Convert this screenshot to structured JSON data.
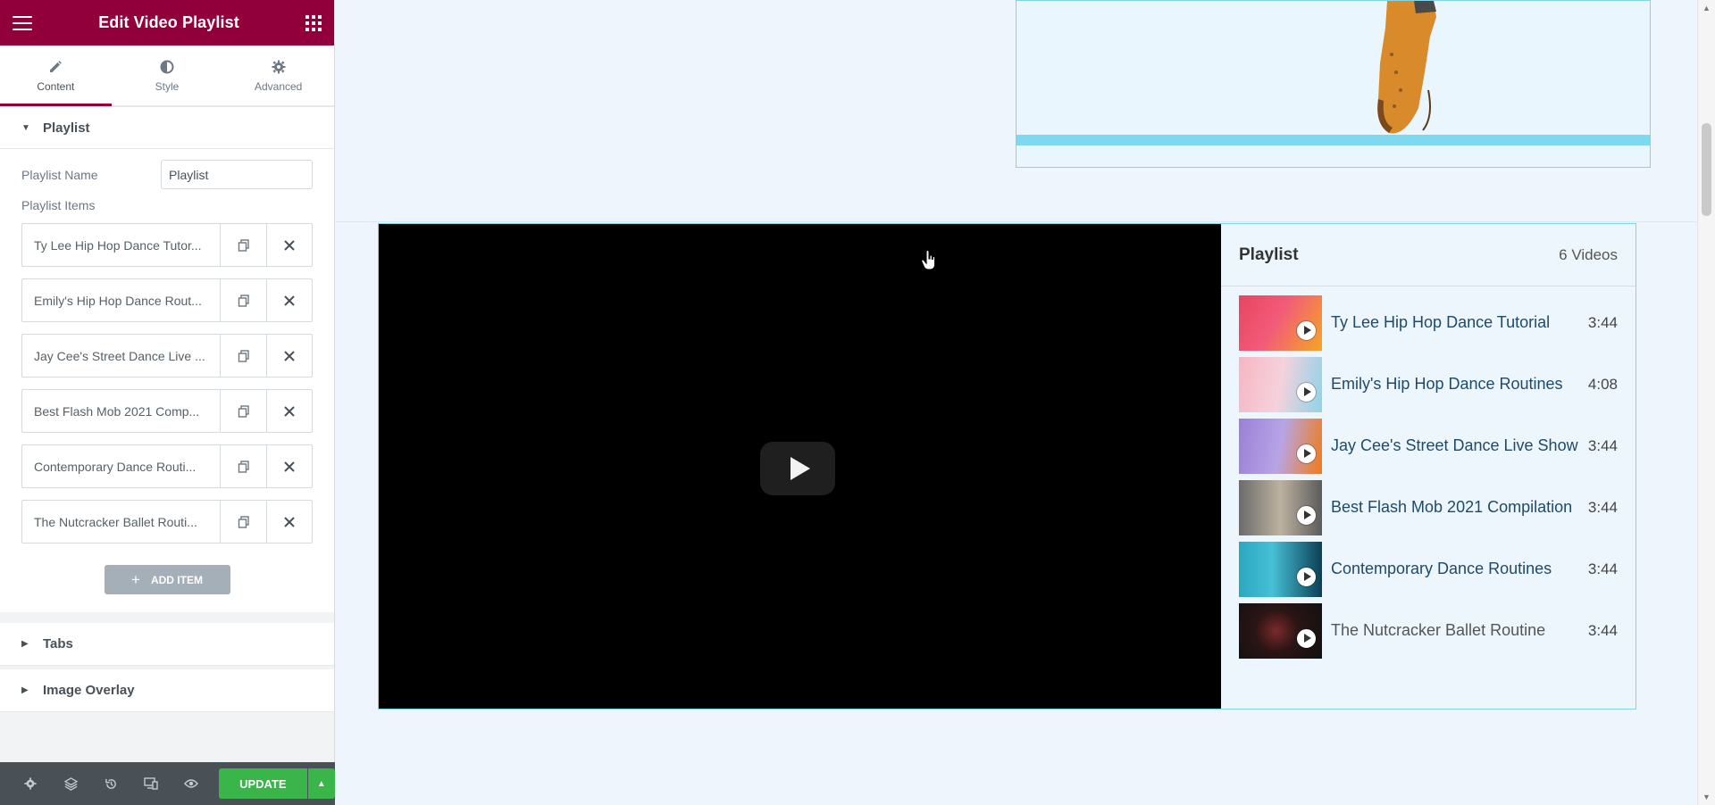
{
  "panel": {
    "title": "Edit Video Playlist",
    "tabs": [
      {
        "label": "Content",
        "icon": "pencil-icon"
      },
      {
        "label": "Style",
        "icon": "contrast-icon"
      },
      {
        "label": "Advanced",
        "icon": "gear-icon"
      }
    ],
    "section_playlist": "Playlist",
    "playlist_name_label": "Playlist Name",
    "playlist_name_value": "Playlist",
    "playlist_items_label": "Playlist Items",
    "items": [
      {
        "title": "Ty Lee Hip Hop Dance Tutor..."
      },
      {
        "title": "Emily's Hip Hop Dance Rout..."
      },
      {
        "title": "Jay Cee's Street Dance Live ..."
      },
      {
        "title": "Best Flash Mob 2021 Comp..."
      },
      {
        "title": "Contemporary Dance Routi..."
      },
      {
        "title": "The Nutcracker Ballet Routi..."
      }
    ],
    "add_item_label": "ADD ITEM",
    "section_tabs": "Tabs",
    "section_image_overlay": "Image Overlay",
    "update_label": "UPDATE",
    "accent_color": "#92003b",
    "update_color": "#39b54a"
  },
  "preview": {
    "playlist_title": "Playlist",
    "video_count": "6 Videos",
    "videos": [
      {
        "name": "Ty Lee Hip Hop Dance Tutorial",
        "duration": "3:44",
        "thumb": [
          "#e8455e",
          "#f5a623"
        ]
      },
      {
        "name": "Emily's Hip Hop Dance Routines",
        "duration": "4:08",
        "thumb": [
          "#f7b6c2",
          "#8fd3e8"
        ]
      },
      {
        "name": "Jay Cee's Street Dance Live Show",
        "duration": "3:44",
        "thumb": [
          "#9b7fd6",
          "#f07b1a"
        ]
      },
      {
        "name": "Best Flash Mob 2021 Compilation",
        "duration": "3:44",
        "thumb": [
          "#6b6b6b",
          "#c9b79c"
        ]
      },
      {
        "name": "Contemporary Dance Routines",
        "duration": "3:44",
        "thumb": [
          "#2aa7c1",
          "#0b3f55"
        ]
      },
      {
        "name": "The Nutcracker Ballet Routine",
        "duration": "3:44",
        "thumb": [
          "#1b1b1b",
          "#7a2a2a"
        ]
      }
    ]
  }
}
